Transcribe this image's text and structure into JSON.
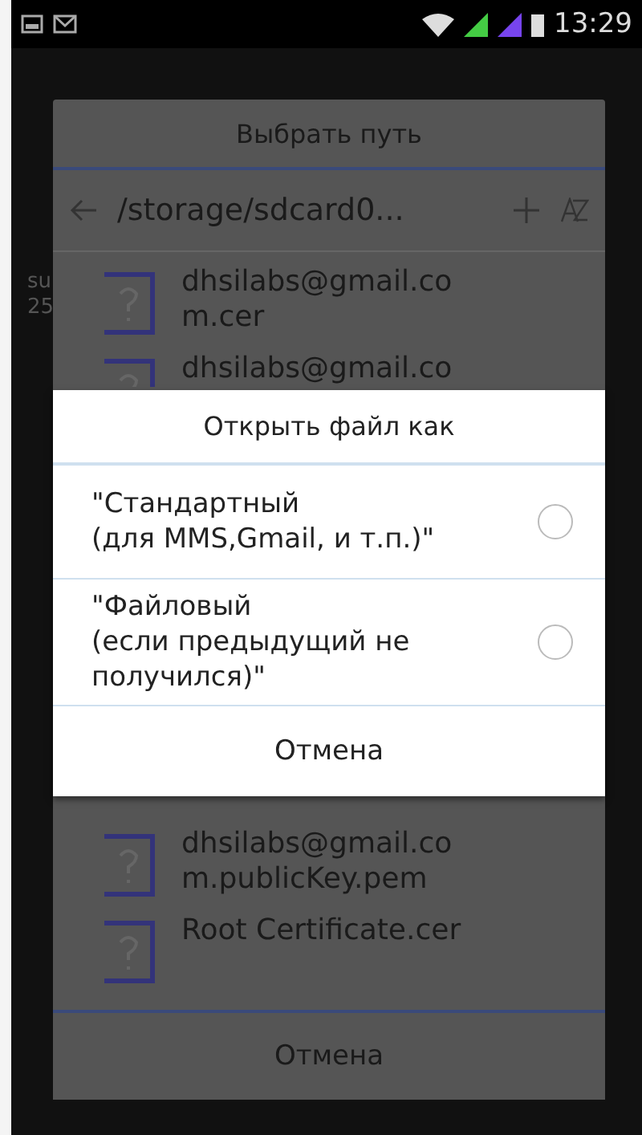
{
  "status_bar": {
    "time": "13:29"
  },
  "background_app": {
    "fragments": [
      "su",
      "25"
    ]
  },
  "path_dialog": {
    "title": "Выбрать путь",
    "path": "/storage/sdcard0...",
    "files": [
      {
        "lines": [
          "dhsilabs@gmail.co",
          "m.cer"
        ]
      },
      {
        "lines": [
          "dhsilabs@gmail.co"
        ]
      },
      {
        "lines": [
          "dhsilabs@gmail.co",
          "m.publicKey.pem"
        ]
      },
      {
        "lines": [
          "Root Certificate.cer"
        ]
      }
    ],
    "cancel": "Отмена"
  },
  "open_dialog": {
    "title": "Открыть файл как",
    "options": [
      {
        "lines": [
          "\"Стандартный",
          "(для MMS,Gmail, и т.п.)\""
        ],
        "selected": false
      },
      {
        "lines": [
          "\"Файловый",
          "(если предыдущий не",
          "получился)\""
        ],
        "selected": false
      }
    ],
    "cancel": "Отмена"
  }
}
